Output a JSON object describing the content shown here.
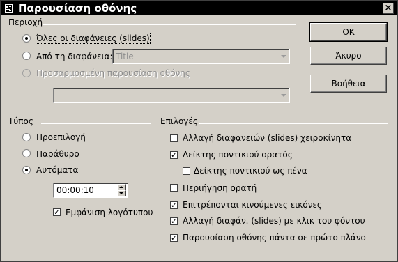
{
  "window": {
    "title": "Παρουσίαση οθόνης"
  },
  "range": {
    "group_label": "Περιοχή",
    "all_slides": "Όλες οι διαφάνειες (slides)",
    "from_slide": "Από τη διαφάνεια:",
    "from_slide_value": "Title",
    "custom_show": "Προσαρμοσμένη παρουσίαση οθόνης",
    "custom_show_value": ""
  },
  "type": {
    "group_label": "Τύπος",
    "default": "Προεπιλογή",
    "window": "Παράθυρο",
    "auto": "Αυτόματα",
    "pause_value": "00:00:10",
    "show_logo": "Εμφάνιση λογότυπου"
  },
  "options": {
    "group_label": "Επιλογές",
    "manual_change": "Αλλαγή διαφανειών (slides) χειροκίνητα",
    "pointer_visible": "Δείκτης ποντικιού ορατός",
    "pointer_as_pen": "Δείκτης ποντικιού ως πένα",
    "navigator_visible": "Περιήγηση ορατή",
    "animations_allowed": "Επιτρέπονται κινούμενες εικόνες",
    "change_on_click": "Αλλαγή διαφάν. (slides) με κλικ του φόντου",
    "always_on_top": "Παρουσίαση οθόνης πάντα σε πρώτο πλάνο"
  },
  "buttons": {
    "ok": "OK",
    "cancel": "Άκυρο",
    "help": "Βοήθεια"
  },
  "state": {
    "range": "all",
    "type": "auto",
    "show_logo": true,
    "manual_change": false,
    "pointer_visible": true,
    "pointer_as_pen": false,
    "navigator_visible": false,
    "animations_allowed": true,
    "change_on_click": true,
    "always_on_top": true
  },
  "icons": {
    "app": "window-icon",
    "close": "close-icon",
    "dropdown": "chevron-down-icon",
    "spin_up": "arrow-up-icon",
    "spin_down": "arrow-down-icon"
  }
}
